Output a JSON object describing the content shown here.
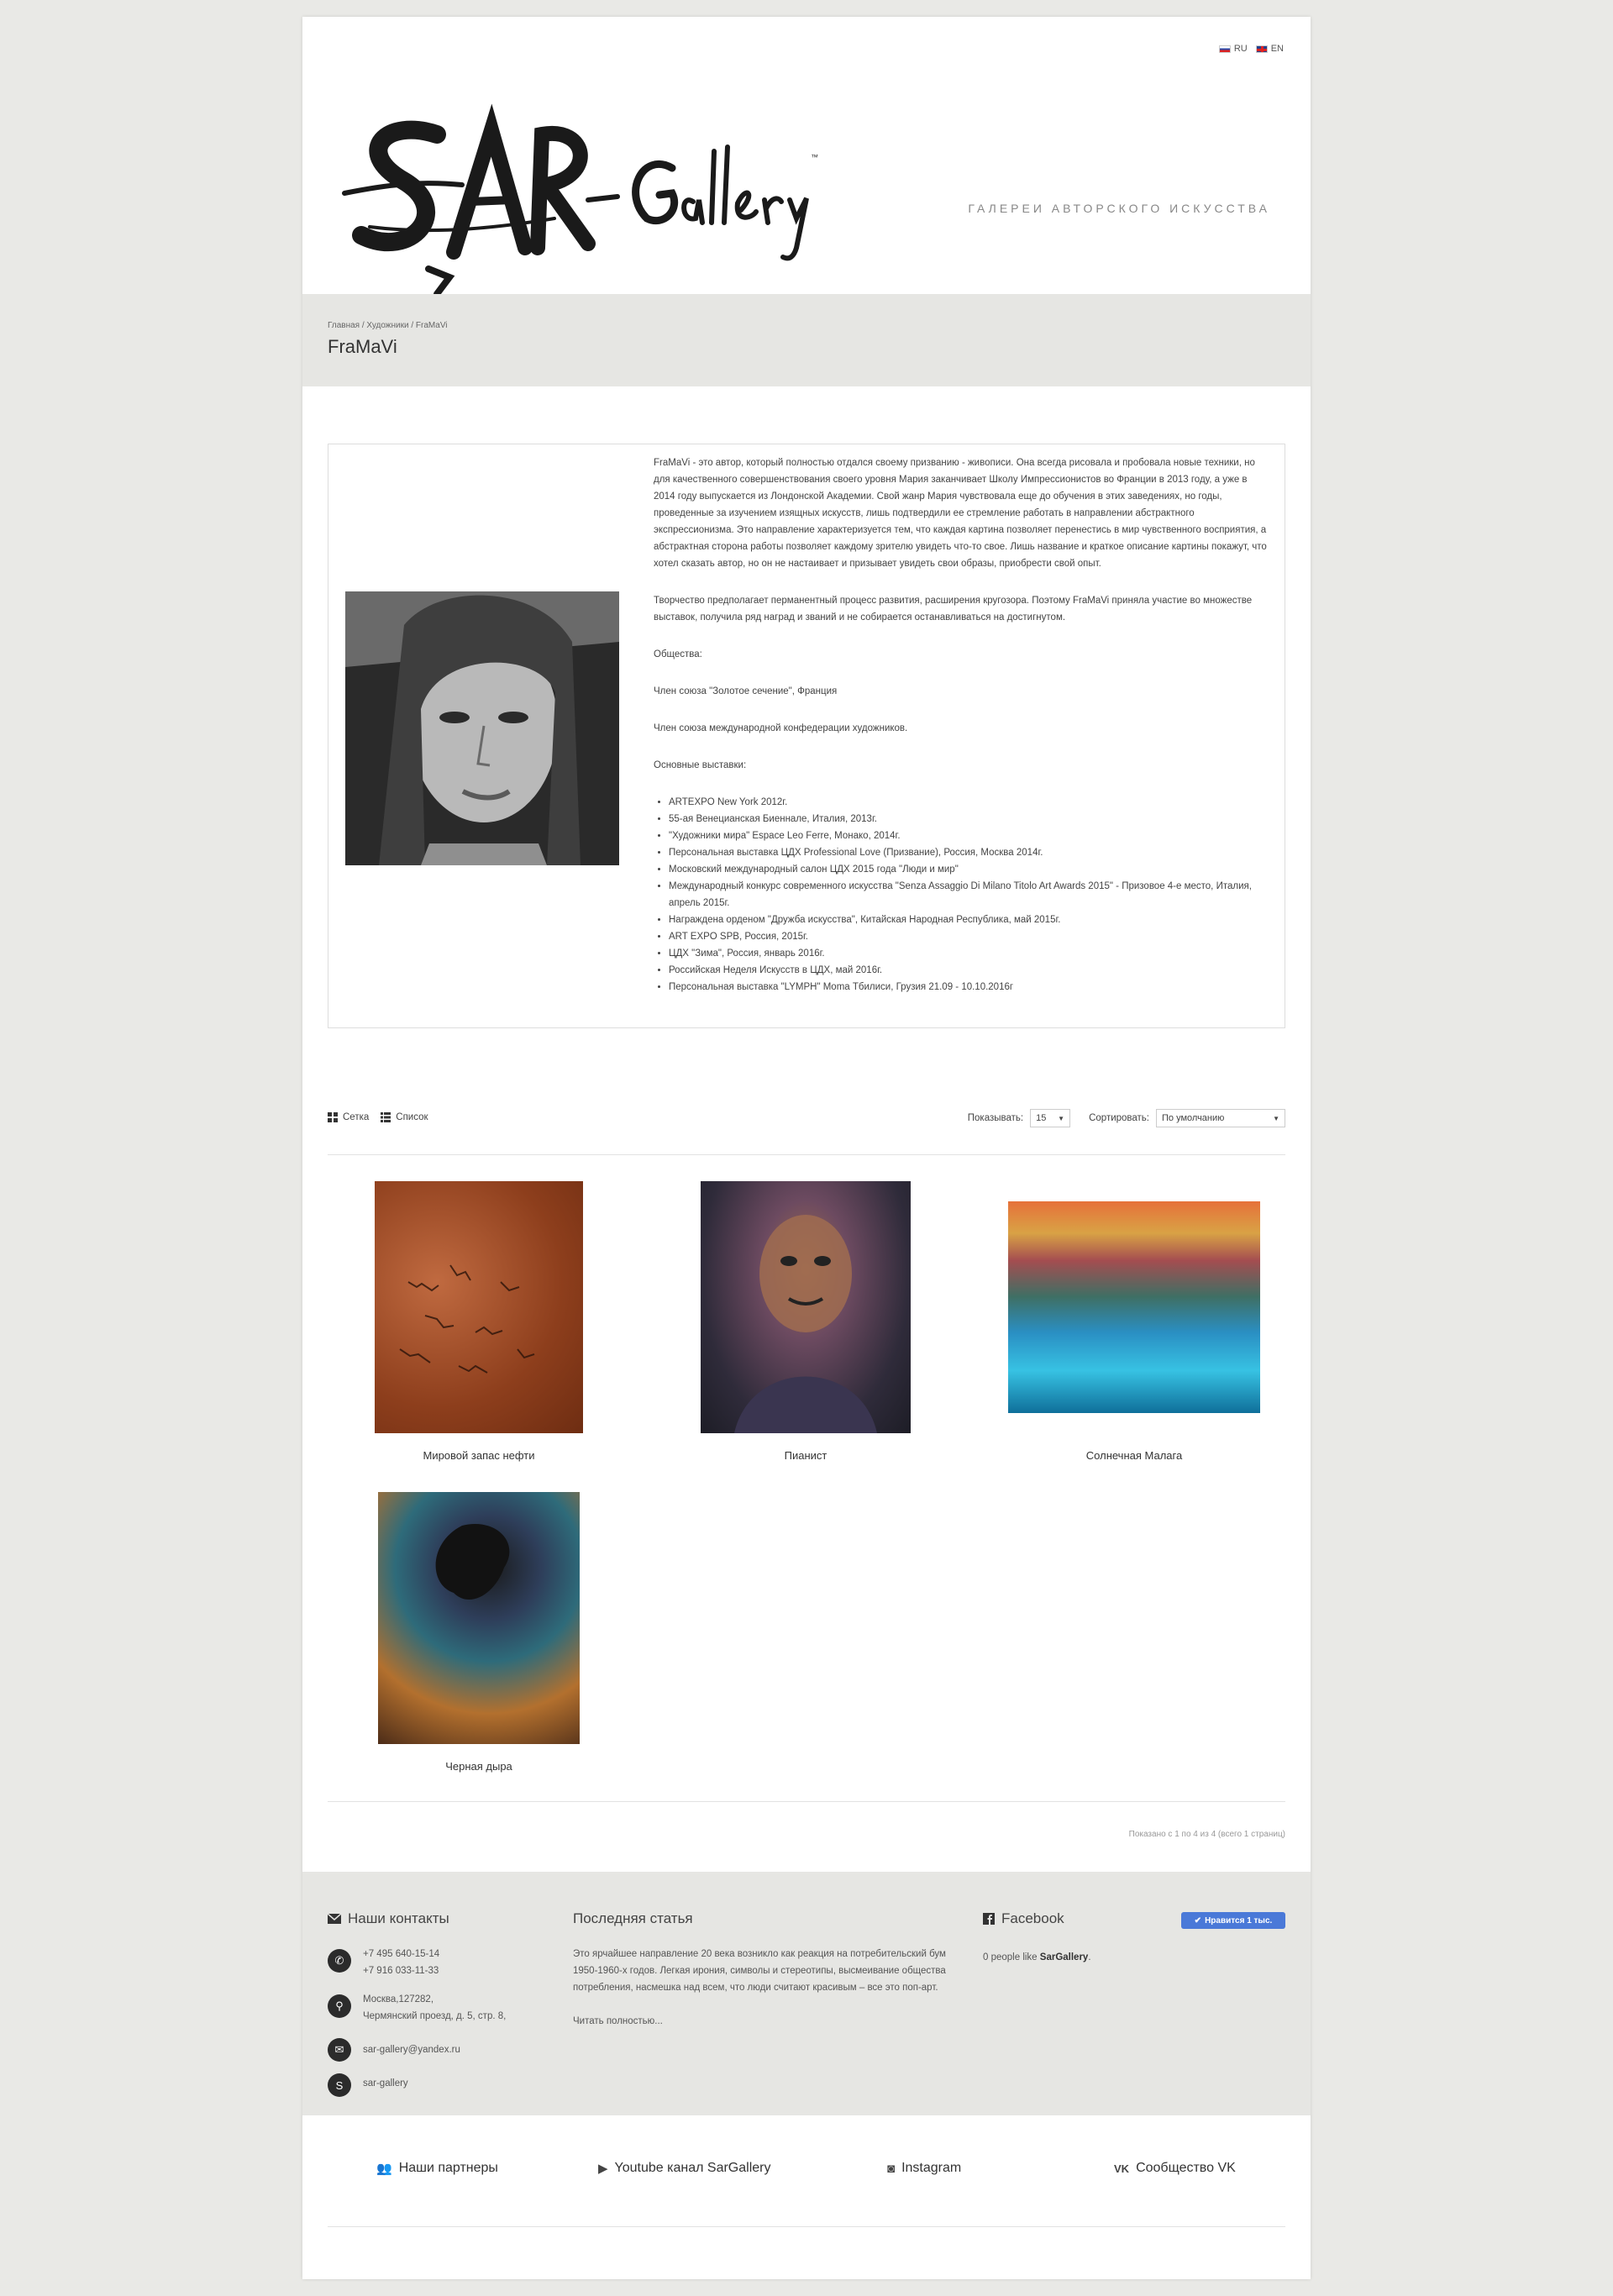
{
  "lang": {
    "ru": "RU",
    "en": "EN"
  },
  "header": {
    "logo_text": "SAR-Gallery",
    "tagline": "ГАЛЕРЕИ АВТОРСКОГО ИСКУССТВА"
  },
  "breadcrumb": {
    "home": "Главная",
    "artists": "Художники",
    "current": "FraMaVi",
    "sep": "/"
  },
  "page_title": "FraMaVi",
  "bio": {
    "p1": "FraMaVi - это автор, который полностью отдался своему призванию - живописи. Она всегда рисовала и пробовала новые техники, но для качественного совершенствования своего уровня Мария заканчивает Школу Импрессионистов во Франции в 2013 году, а уже в 2014 году выпускается из Лондонской Академии. Свой жанр Мария чувствовала еще до обучения в этих заведениях, но годы, проведенные за изучением изящных искусств, лишь подтвердили ее стремление работать в направлении абстрактного экспрессионизма. Это направление характеризуется тем, что каждая картина позволяет перенестись в мир чувственного восприятия, а абстрактная сторона работы позволяет каждому зрителю увидеть что-то свое. Лишь название и краткое описание картины покажут, что хотел сказать автор, но он не настаивает и призывает увидеть свои образы, приобрести свой опыт.",
    "p2": "Творчество предполагает перманентный процесс развития, расширения кругозора. Поэтому FraMaVi приняла участие во множестве выставок, получила ряд наград и званий и не собирается останавливаться на достигнутом.",
    "p3": "Общества:",
    "p4": "Член союза \"Золотое сечение\", Франция",
    "p5": "Член союза международной конфедерации художников.",
    "p6": "Основные выставки:",
    "exhibitions": [
      "ARTEXPO New York 2012г.",
      "55-ая Венецианская Биеннале, Италия, 2013г.",
      "\"Художники мира\" Espace Leo Ferre, Монако, 2014г.",
      "Персональная выставка ЦДХ Professional Love (Призвание), Россия, Москва 2014г.",
      "Московский международный салон ЦДХ 2015 года \"Люди и мир\"",
      "Международный конкурс современного искусства \"Senza Assaggio Di Milano Titolo Art Awards 2015\" - Призовое 4-е место, Италия, апрель 2015г.",
      "Награждена орденом \"Дружба искусства\", Китайская Народная Республика, май 2015г.",
      "ART EXPO SPB, Россия, 2015г.",
      "ЦДХ \"Зима\", Россия, январь 2016г.",
      "Российская Неделя Искусств в ЦДХ, май 2016г.",
      "Персональная выставка \"LYMPH\" Moma Тбилиси, Грузия 21.09 - 10.10.2016г"
    ]
  },
  "toolbar": {
    "grid": "Сетка",
    "list": "Список",
    "show_label": "Показывать:",
    "show_value": "15",
    "sort_label": "Сортировать:",
    "sort_value": "По умолчанию"
  },
  "artworks": [
    {
      "title": "Мировой запас нефти"
    },
    {
      "title": "Пианист"
    },
    {
      "title": "Солнечная Малага"
    },
    {
      "title": "Черная дыра"
    }
  ],
  "showing": "Показано с 1 по 4 из 4 (всего 1 страниц)",
  "footer": {
    "contacts_title": "Наши контакты",
    "phone1": "+7 495 640-15-14",
    "phone2": "+7 916 033-11-33",
    "address1": "Москва,127282,",
    "address2": "Чермянский проезд, д. 5, стр. 8,",
    "email": "sar-gallery@yandex.ru",
    "skype": "sar-gallery",
    "article_title": "Последняя статья",
    "article_text": "Это ярчайшее направление 20 века возникло как реакция на потребительский бум 1950-1960-х годов. Легкая ирония, символы и стереотипы, высмеивание общества потребления, насмешка над всем, что люди считают красивым – все это поп-арт.",
    "read_more": "Читать полностью...",
    "fb_title": "Facebook",
    "fb_like": "Нравится 1 тыс.",
    "fb_people": "0 people like",
    "fb_name": "SarGallery"
  },
  "bottom_links": {
    "partners": "Наши партнеры",
    "youtube": "Youtube канал SarGallery",
    "instagram": "Instagram",
    "vk": "Сообщество VK"
  },
  "colors": {
    "accent_button": "#4a79d8",
    "footer_bg": "#e6e6e3"
  }
}
